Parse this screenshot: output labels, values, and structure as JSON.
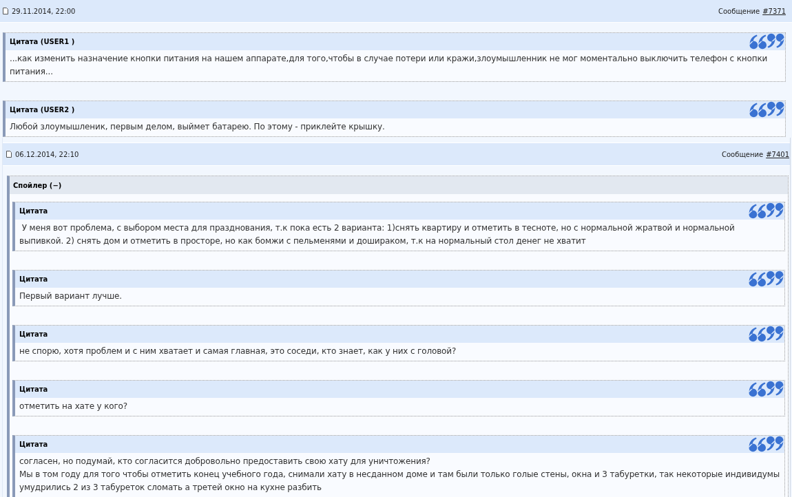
{
  "posts": [
    {
      "date": "29.11.2014, 22:00",
      "message_label": "Сообщение",
      "message_link": "#7371",
      "blocks": [
        {
          "kind": "quote",
          "title": "Цитата (USER1 )",
          "paragraphs": [
            "...как изменить назначение кнопки питания на нашем аппарате,для того,чтобы в случае потери или кражи,злоумышленник не мог моментально выключить телефон с кнопки питания..."
          ]
        },
        {
          "kind": "quote",
          "title": "Цитата (USER2 )",
          "paragraphs": [
            "Любой злоумышленик, первым делом, выймет батарею. По этому - приклейте крышку."
          ]
        }
      ]
    },
    {
      "date": "06.12.2014, 22:10",
      "message_label": "Сообщение",
      "message_link": "#7401",
      "blocks": [
        {
          "kind": "spoiler",
          "title": "Спойлер (−)",
          "expanded": true,
          "children": [
            {
              "kind": "quote",
              "title": "Цитата",
              "paragraphs": [
                " У меня вот проблема, с выбором места для празднования, т.к пока есть 2 варианта: 1)снять квартиру и отметить в тесноте, но с нормальной жратвой и нормальной выпивкой. 2) снять дом и отметить в просторе, но как бомжи с пельменями и дошираком, т.к на нормальный стол денег не хватит"
              ]
            },
            {
              "kind": "quote",
              "title": "Цитата",
              "paragraphs": [
                "Первый вариант лучше."
              ]
            },
            {
              "kind": "quote",
              "title": "Цитата",
              "paragraphs": [
                "не спорю, хотя проблем и с ним хватает и самая главная, это соседи, кто знает, как у них с головой?"
              ]
            },
            {
              "kind": "quote",
              "title": "Цитата",
              "paragraphs": [
                "отметить на хате у кого?"
              ]
            },
            {
              "kind": "quote",
              "title": "Цитата",
              "paragraphs": [
                "согласен, но подумай, кто согласится добровольно предоставить свою хату для уничтожения?",
                "Мы в том году для того чтобы отметить конец учебного года, снимали хату в несданном доме и там были только голые стены, окна и 3 табуретки, так некоторые индивидумы умудрились 2 из 3 табуреток сломать а третей окно на кухне разбить"
              ]
            }
          ]
        }
      ]
    }
  ]
}
